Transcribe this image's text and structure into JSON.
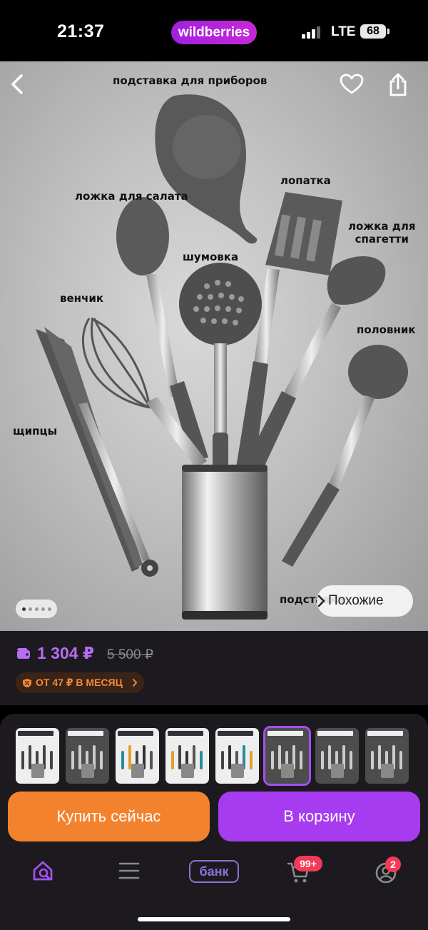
{
  "status_bar": {
    "time": "21:37",
    "brand": "wildberries",
    "network": "LTE",
    "battery": "68"
  },
  "product_image": {
    "labels": {
      "stand_top": "подставка для приборов",
      "salad_spoon": "ложка для салата",
      "spatula": "лопатка",
      "spaghetti_spoon": "ложка для\nспагетти",
      "skimmer": "шумовка",
      "whisk": "венчик",
      "ladle": "половник",
      "tongs": "щипцы",
      "stand_bottom": "подставка"
    },
    "gallery_dots": {
      "total": 5,
      "active": 1
    },
    "similar_label": "Похожие"
  },
  "price": {
    "current": "1 304 ₽",
    "old": "5 500 ₽",
    "installment": "ОТ 47 ₽ В МЕСЯЦ"
  },
  "thumbnails": [
    {
      "title": "НАБОР КУХОННЫЙ",
      "style": "light"
    },
    {
      "title": "НАБОР КУХОННЫЙ",
      "style": "dark"
    },
    {
      "title": "НАБОР КУХОННЫХ ПРИНАДЛЕЖНОСТЕЙ",
      "style": "light"
    },
    {
      "title": "НАБОР КУХОННЫХ ПРИНАДЛЕЖНОСТЕЙ",
      "style": "light"
    },
    {
      "title": "НАБОР КУХОННЫХ ПРИНАДЛЕЖНОСТЕЙ",
      "style": "light"
    },
    {
      "title": "НАБОР КУХОННЫЙ",
      "style": "dark",
      "selected": true
    },
    {
      "title": "НАБОР КУХОННЫХ ПРИНАДЛЕЖНОСТЕЙ",
      "style": "dark"
    },
    {
      "title": "НАБОР КУХОННЫЙ",
      "style": "dark"
    }
  ],
  "actions": {
    "buy_now": "Купить сейчас",
    "add_to_cart": "В корзину"
  },
  "nav": {
    "bank": "банк",
    "cart_badge": "99+",
    "profile_badge": "2"
  },
  "colors": {
    "accent": "#a73bf0",
    "buy": "#f3822f",
    "price": "#b86cf2",
    "badge": "#f33a56"
  }
}
